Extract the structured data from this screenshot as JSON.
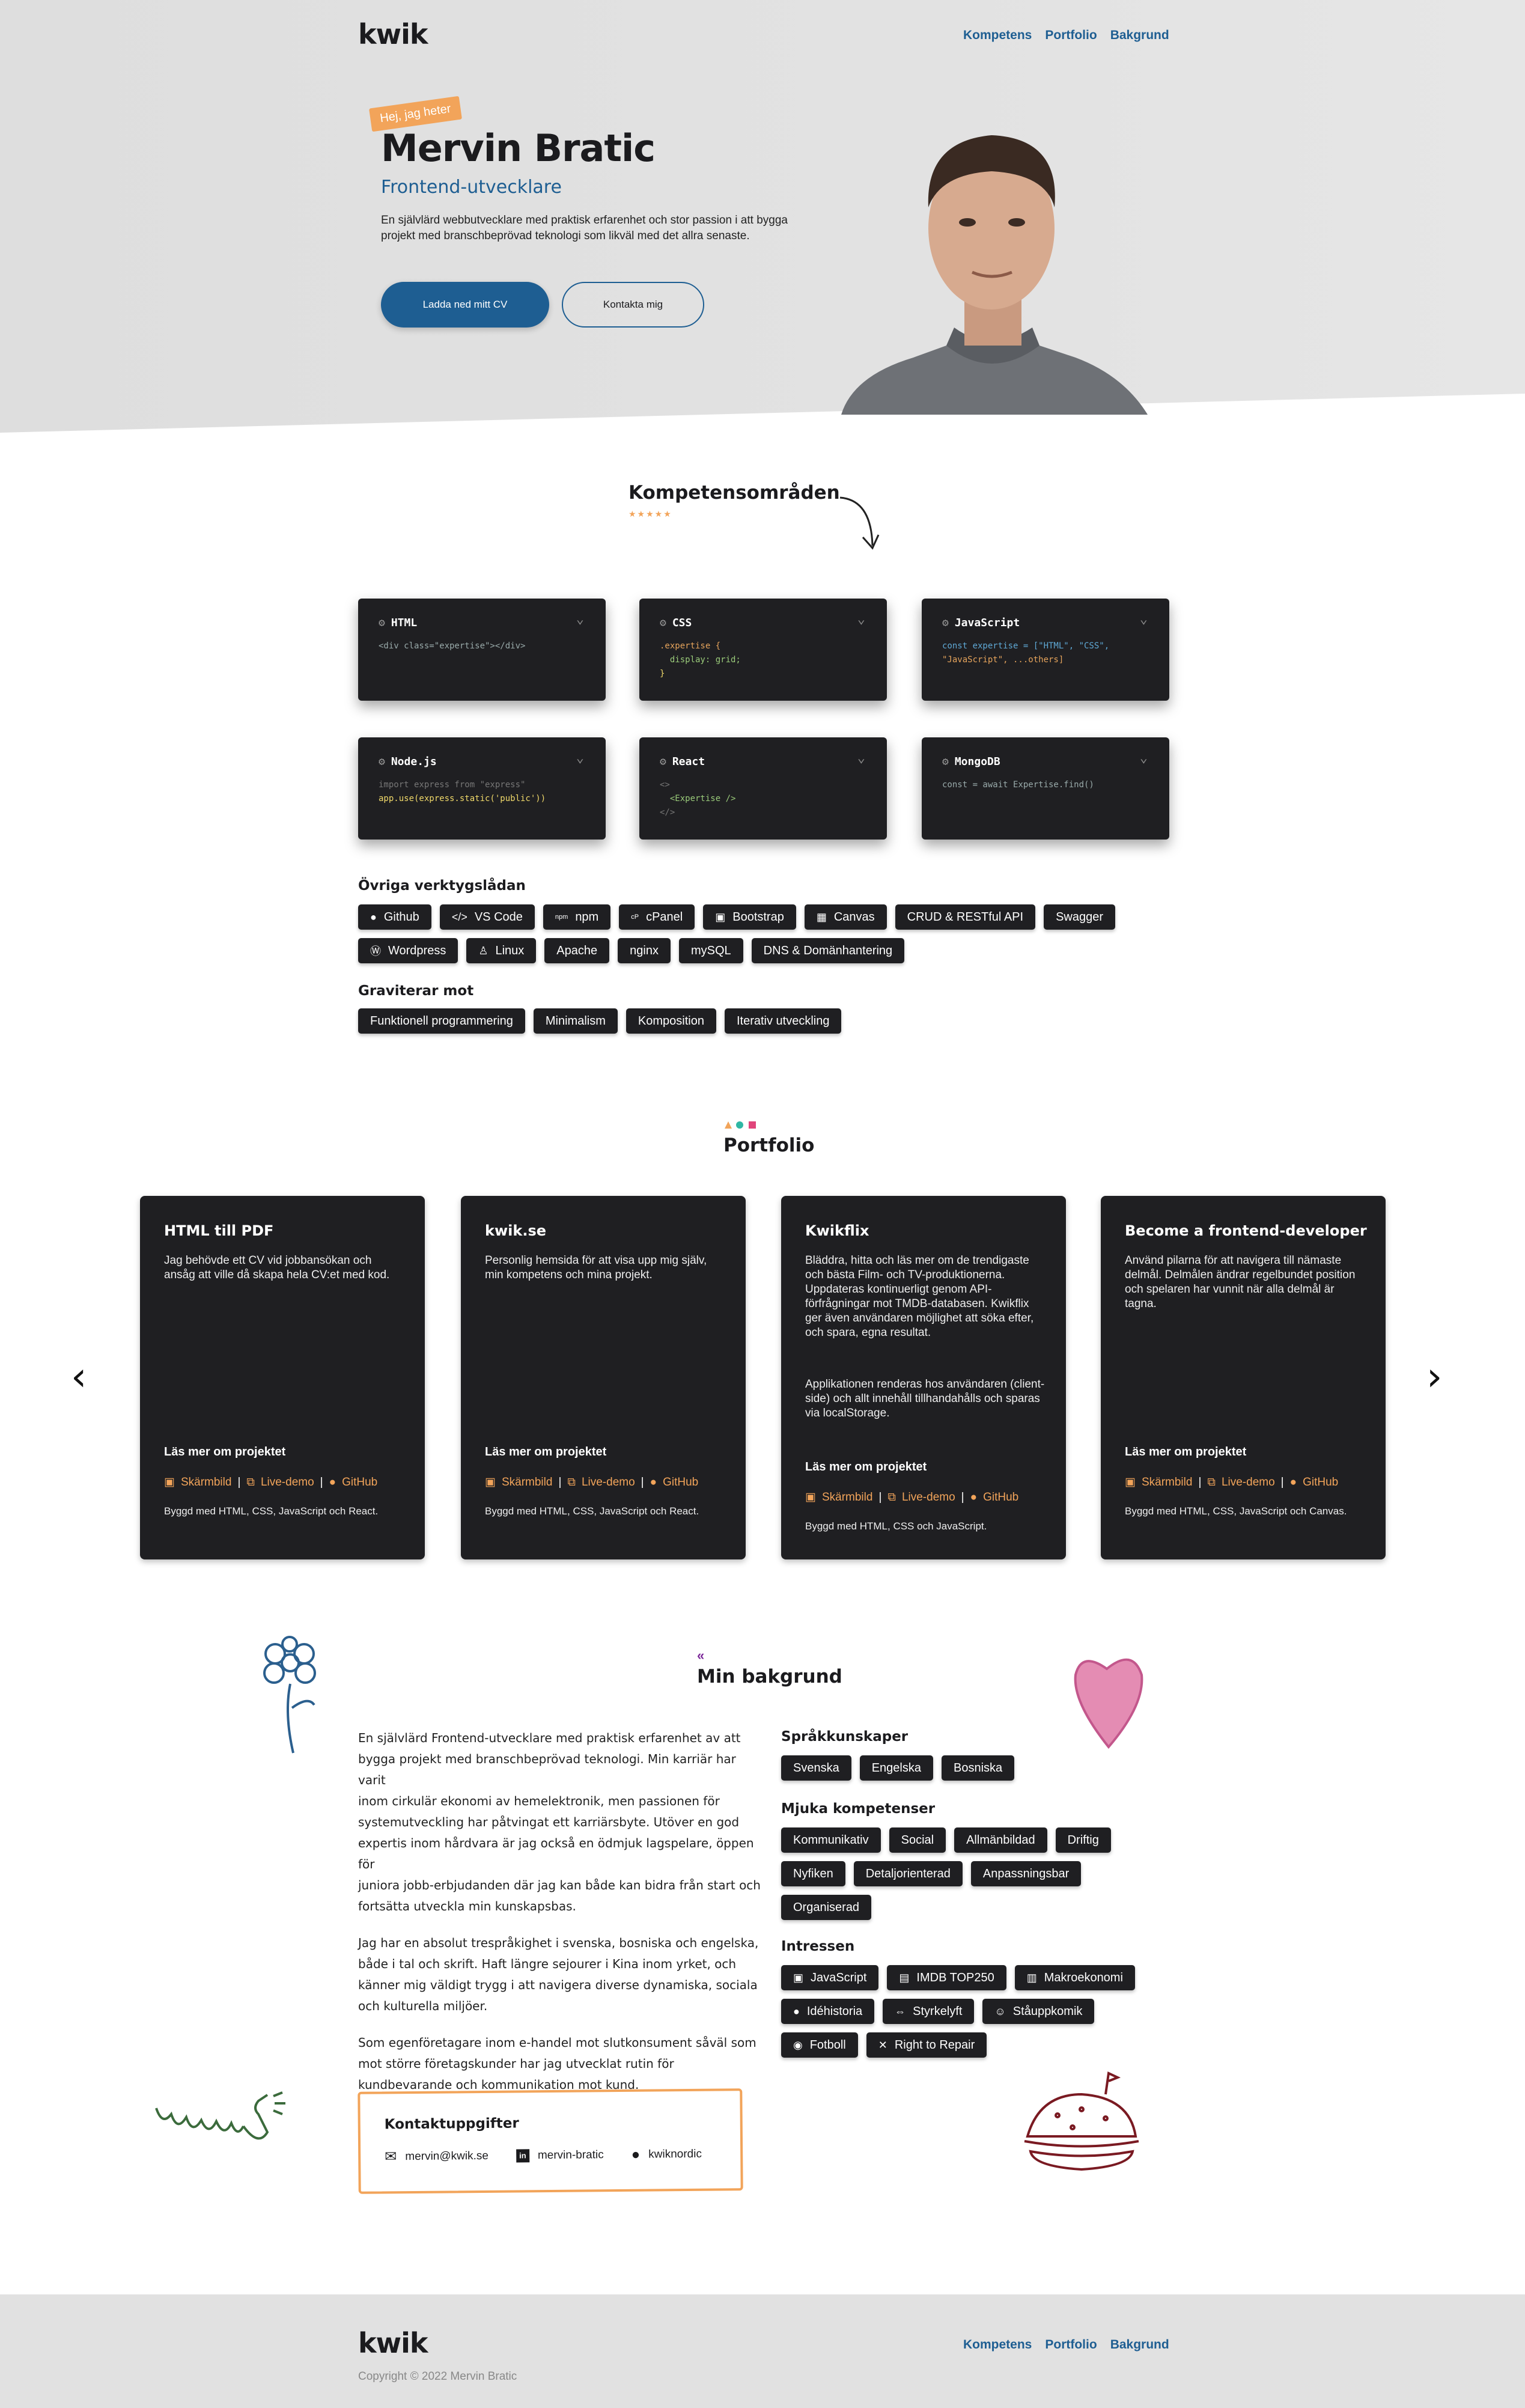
{
  "header": {
    "logo": "kwik",
    "nav": [
      "Kompetens",
      "Portfolio",
      "Bakgrund"
    ]
  },
  "hero": {
    "badge": "Hej, jag heter",
    "name": "Mervin Bratic",
    "role": "Frontend-utvecklare",
    "intro_line1": "En självlärd webbutvecklare med praktisk erfarenhet och stor passion i att bygga",
    "intro_line2": "projekt med branschbeprövad teknologi som likväl med det allra senaste.",
    "cv_button": "Ladda ned mitt CV",
    "contact_button": "Kontakta mig"
  },
  "skills": {
    "title": "Kompetensområden",
    "stars": "★★★★★",
    "cards": [
      {
        "title": "HTML",
        "code": [
          "<div class=\"expertise\"></div>"
        ]
      },
      {
        "title": "CSS",
        "code": [
          ".expertise {",
          "  display: grid;",
          "}"
        ]
      },
      {
        "title": "JavaScript",
        "code": [
          "const expertise = [\"HTML\", \"CSS\",",
          "\"JavaScript\", ...others]"
        ]
      },
      {
        "title": "Node.js",
        "code": [
          "import express from \"express\"",
          "",
          "app.use(express.static('public'))"
        ]
      },
      {
        "title": "React",
        "code": [
          "<>",
          "  <Expertise />",
          "</>"
        ]
      },
      {
        "title": "MongoDB",
        "code": [
          "const = await Expertise.find()"
        ]
      }
    ],
    "toolbox_title": "Övriga verktygslådan",
    "toolbox": [
      {
        "label": "Github",
        "icon": "github-icon"
      },
      {
        "label": "VS Code",
        "icon": "code-icon"
      },
      {
        "label": "npm",
        "icon": "npm-icon"
      },
      {
        "label": "cPanel",
        "icon": "cpanel-icon"
      },
      {
        "label": "Bootstrap",
        "icon": "bootstrap-icon"
      },
      {
        "label": "Canvas",
        "icon": "canvas-icon"
      },
      {
        "label": "CRUD & RESTful API",
        "icon": ""
      },
      {
        "label": "Swagger",
        "icon": ""
      },
      {
        "label": "Wordpress",
        "icon": "wordpress-icon"
      },
      {
        "label": "Linux",
        "icon": "linux-icon"
      },
      {
        "label": "Apache",
        "icon": ""
      },
      {
        "label": "nginx",
        "icon": ""
      },
      {
        "label": "mySQL",
        "icon": ""
      },
      {
        "label": "DNS & Domänhantering",
        "icon": ""
      }
    ],
    "gravitate_title": "Graviterar mot",
    "gravitate": [
      "Funktionell programmering",
      "Minimalism",
      "Komposition",
      "Iterativ utveckling"
    ]
  },
  "portfolio": {
    "title": "Portfolio",
    "projects": [
      {
        "title": "HTML till PDF",
        "desc": "Jag behövde ett CV vid jobbansökan och ansåg att ville då skapa hela CV:et med kod.",
        "more": "Läs mer om projektet",
        "links": [
          "Skärmbild",
          "Live-demo",
          "GitHub"
        ],
        "built": "Byggd med HTML, CSS, JavaScript och React."
      },
      {
        "title": "kwik.se",
        "desc": "Personlig hemsida för att visa upp mig själv, min kompetens och mina projekt.",
        "more": "Läs mer om projektet",
        "links": [
          "Skärmbild",
          "Live-demo",
          "GitHub"
        ],
        "built": "Byggd med HTML, CSS, JavaScript och React."
      },
      {
        "title": "Kwikflix",
        "desc": "Bläddra, hitta och läs mer om de trendigaste och bästa Film- och TV-produktionerna. Uppdateras kontinuerligt genom API-förfrågningar mot TMDB-databasen. Kwikflix ger även användaren möjlighet att söka efter, och spara, egna resultat.",
        "desc2": "Applikationen renderas hos användaren (client-side) och allt innehåll tillhandahålls och sparas via localStorage.",
        "more": "Läs mer om projektet",
        "links": [
          "Skärmbild",
          "Live-demo",
          "GitHub"
        ],
        "built": "Byggd med HTML, CSS och JavaScript."
      },
      {
        "title": "Become a frontend-developer",
        "desc": "Använd pilarna för att navigera till nämaste delmål. Delmålen ändrar regelbundet position och spelaren har vunnit när alla delmål är tagna.",
        "more": "Läs mer om projektet",
        "links": [
          "Skärmbild",
          "Live-demo",
          "GitHub"
        ],
        "built": "Byggd med HTML, CSS, JavaScript och Canvas."
      }
    ]
  },
  "background": {
    "title": "Min bakgrund",
    "p1": [
      "En självlärd Frontend-utvecklare med praktisk erfarenhet av att",
      "bygga projekt med branschbeprövad teknologi. Min karriär har varit",
      "inom cirkulär ekonomi av hemelektronik, men passionen för",
      "systemutveckling har påtvingat ett karriärsbyte. Utöver en god",
      "expertis inom hårdvara är jag också en ödmjuk lagspelare, öppen för",
      "juniora jobb-erbjudanden där jag kan både kan bidra från start och",
      "fortsätta utveckla min kunskapsbas."
    ],
    "p2": [
      "Jag har en absolut trespråkighet i svenska, bosniska och engelska,",
      "både i tal och skrift. Haft längre sejourer i Kina inom yrket, och",
      "känner mig väldigt trygg i att navigera diverse dynamiska, sociala",
      "och kulturella miljöer."
    ],
    "p3": [
      "Som egenföretagare inom e-handel mot slutkonsument såväl som",
      "mot större företagskunder har jag utvecklat rutin för",
      "kundbevarande och kommunikation mot kund."
    ],
    "languages_title": "Språkkunskaper",
    "languages": [
      "Svenska",
      "Engelska",
      "Bosniska"
    ],
    "soft_title": "Mjuka kompetenser",
    "soft": [
      "Kommunikativ",
      "Social",
      "Allmänbildad",
      "Driftig",
      "Nyfiken",
      "Detaljorienterad",
      "Anpassningsbar",
      "Organiserad"
    ],
    "interests_title": "Intressen",
    "interests": [
      {
        "label": "JavaScript",
        "icon": "js-icon"
      },
      {
        "label": "IMDB TOP250",
        "icon": "film-icon"
      },
      {
        "label": "Makroekonomi",
        "icon": "money-icon"
      },
      {
        "label": "Idéhistoria",
        "icon": "bulb-icon"
      },
      {
        "label": "Styrkelyft",
        "icon": "dumbbell-icon"
      },
      {
        "label": "Ståuppkomik",
        "icon": "mask-icon"
      },
      {
        "label": "Fotboll",
        "icon": "football-icon"
      },
      {
        "label": "Right to Repair",
        "icon": "tools-icon"
      }
    ],
    "contact_title": "Kontaktuppgifter",
    "email": "mervin@kwik.se",
    "linkedin": "mervin-bratic",
    "github": "kwiknordic"
  },
  "footer": {
    "logo": "kwik",
    "nav": [
      "Kompetens",
      "Portfolio",
      "Bakgrund"
    ],
    "copyright": "Copyright © 2022 Mervin Bratic"
  },
  "colors": {
    "accent": "#1e5e92",
    "orange": "#f2a45a",
    "dark": "#1f1f22"
  }
}
